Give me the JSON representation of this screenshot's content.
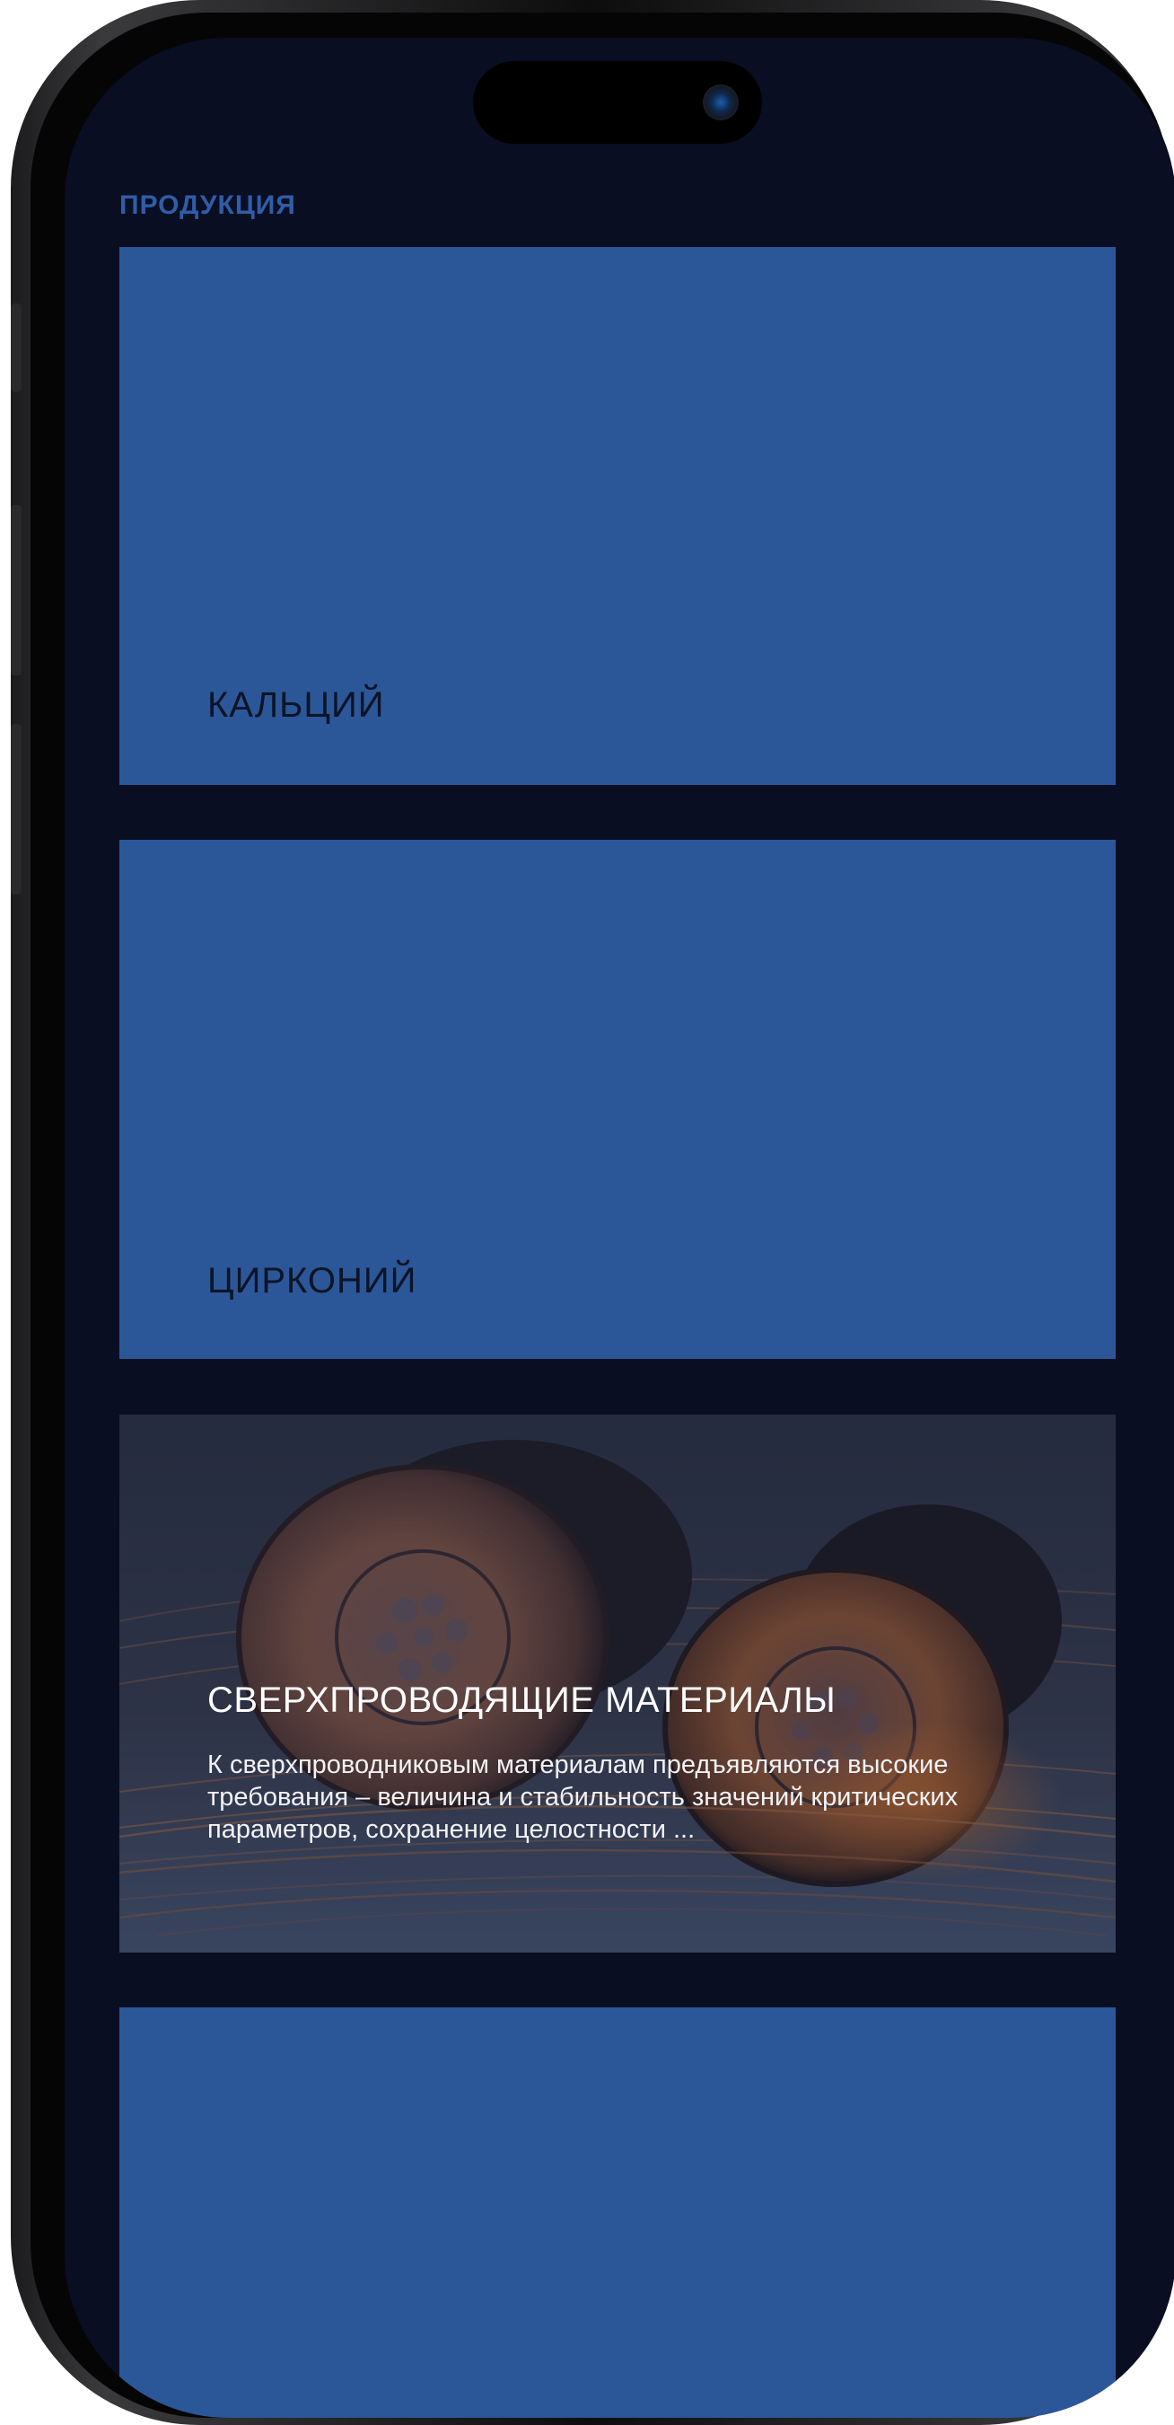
{
  "header": {
    "title": "ПРОДУКЦИЯ"
  },
  "products": [
    {
      "title": "КАЛЬЦИЙ",
      "description": ""
    },
    {
      "title": "ЦИРКОНИЙ",
      "description": ""
    },
    {
      "title": "СВЕРХПРОВОДЯЩИЕ МАТЕРИАЛЫ",
      "description": "К сверхпроводниковым материалам предъявляются высокие требования – величина и стабильность значений критических параметров, сохранение целостности ..."
    },
    {
      "title": "",
      "description": ""
    }
  ],
  "colors": {
    "background": "#0a0e22",
    "card": "#2b5799",
    "accent": "#2f5da8",
    "card_title": "#0c1426"
  }
}
